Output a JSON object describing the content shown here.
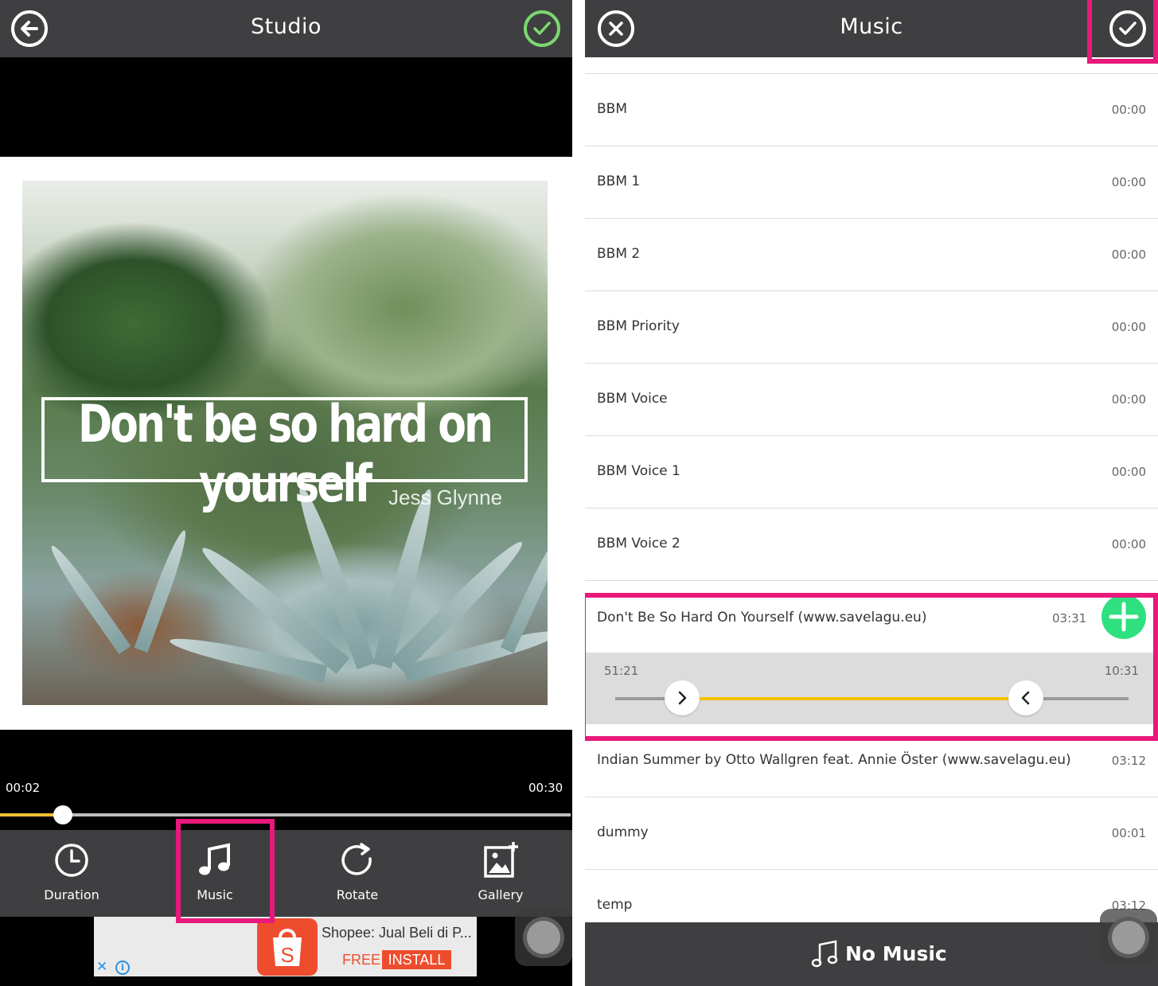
{
  "studio": {
    "title": "Studio",
    "quote": "Don't be so hard on yourself",
    "artist": "Jess Glynne",
    "time_current": "00:02",
    "time_total": "00:30",
    "progress_fraction": 0.11,
    "tools": [
      {
        "label": "Duration",
        "icon": "clock-icon"
      },
      {
        "label": "Music",
        "icon": "music-note-icon"
      },
      {
        "label": "Rotate",
        "icon": "rotate-icon"
      },
      {
        "label": "Gallery",
        "icon": "gallery-icon"
      }
    ],
    "ad": {
      "title": "Shopee: Jual Beli di P...",
      "free": "FREE",
      "install": "INSTALL",
      "close": "✕",
      "info": "i"
    }
  },
  "music": {
    "title": "Music",
    "tracks": [
      {
        "name": "BBM",
        "duration": "00:00"
      },
      {
        "name": "BBM 1",
        "duration": "00:00"
      },
      {
        "name": "BBM 2",
        "duration": "00:00"
      },
      {
        "name": "BBM Priority",
        "duration": "00:00"
      },
      {
        "name": "BBM Voice",
        "duration": "00:00"
      },
      {
        "name": "BBM Voice 1",
        "duration": "00:00"
      },
      {
        "name": "BBM Voice 2",
        "duration": "00:00"
      }
    ],
    "selected": {
      "name": "Don't Be So Hard On Yourself (www.savelagu.eu)",
      "duration": "03:31",
      "trim_start": "51:21",
      "trim_end": "10:31",
      "range_start_fraction": 0.13,
      "range_end_fraction": 0.8
    },
    "tracks_after": [
      {
        "name": "Indian Summer by Otto Wallgren feat. Annie Öster (www.savelagu.eu)",
        "duration": "03:12"
      },
      {
        "name": "dummy",
        "duration": "00:01"
      },
      {
        "name": "temp",
        "duration": "03:12"
      }
    ],
    "no_music_label": "No Music"
  },
  "colors": {
    "toolbar_bg": "#3f3f41",
    "accent_yellow": "#f5c100",
    "confirm_green": "#7bd86f",
    "add_green": "#2ee07f",
    "highlight_pink": "#e8197a",
    "shopee_orange": "#ee4d2d"
  }
}
